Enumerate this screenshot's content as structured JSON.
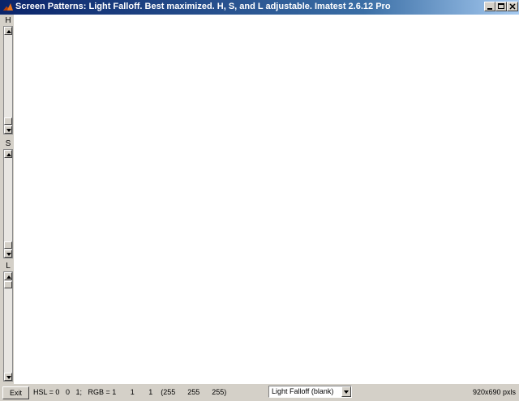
{
  "window": {
    "title": "Screen Patterns: Light Falloff.  Best maximized.  H, S, and L adjustable.  Imatest 2.6.12  Pro",
    "icon": "matlab-logo-icon",
    "controls": [
      "minimize-icon",
      "maximize-icon",
      "close-icon"
    ]
  },
  "sliders": [
    {
      "label": "H",
      "value": 0
    },
    {
      "label": "S",
      "value": 0
    },
    {
      "label": "L",
      "value": 1
    }
  ],
  "status": {
    "exit_label": "Exit",
    "readout": "HSL = 0   0   1;   RGB = 1       1       1    (255      255      255)",
    "pattern_selected": "Light Falloff (blank)",
    "size": "920x690 pxls"
  },
  "colors": {
    "titlebar_start": "#0a246a",
    "titlebar_end": "#a6caf0",
    "face": "#d4d0c8",
    "canvas": "#ffffff"
  }
}
